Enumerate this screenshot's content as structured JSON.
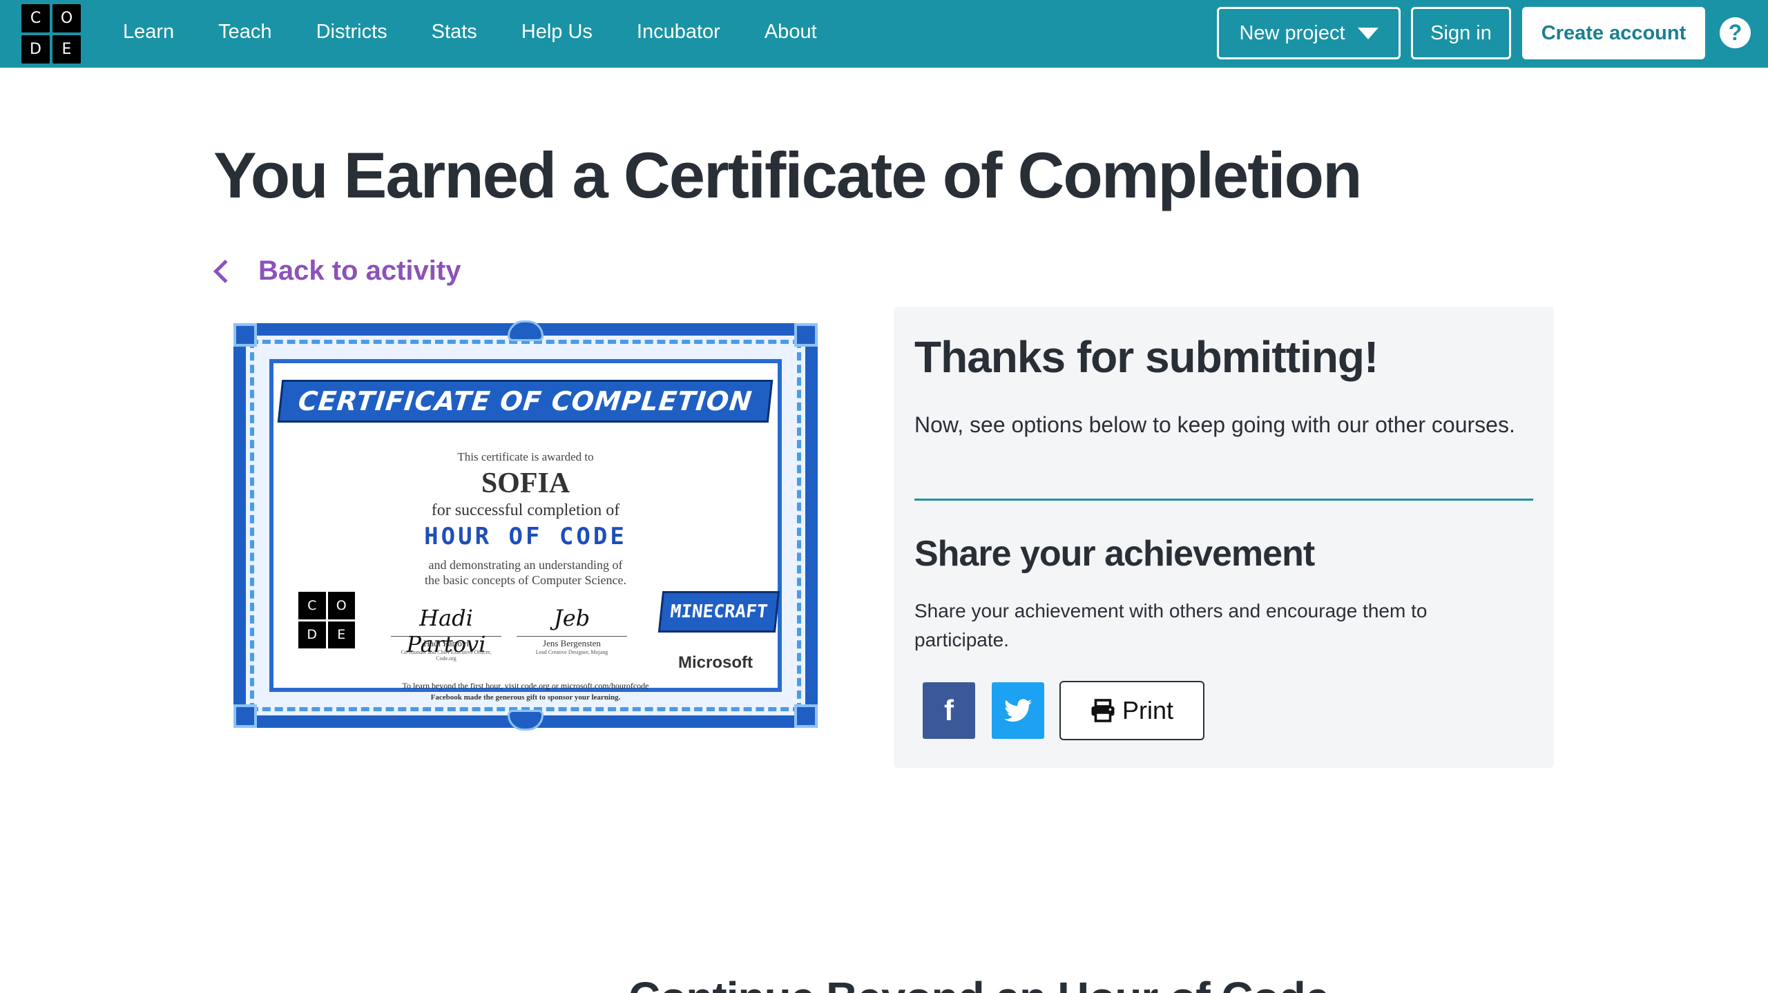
{
  "nav": {
    "logo_letters": [
      "C",
      "O",
      "D",
      "E"
    ],
    "links": [
      "Learn",
      "Teach",
      "Districts",
      "Stats",
      "Help Us",
      "Incubator",
      "About"
    ],
    "new_project_label": "New project",
    "sign_in_label": "Sign in",
    "create_account_label": "Create account",
    "help_icon": "?"
  },
  "page": {
    "title": "You Earned a Certificate of Completion",
    "back_link": "Back to activity"
  },
  "certificate": {
    "heading": "CERTIFICATE OF COMPLETION",
    "awarded_to_text": "This certificate is awarded to",
    "name": "SOFIA",
    "for_text": "for successful completion of",
    "course": "HOUR OF CODE",
    "demonstrating_line1": "and demonstrating an understanding of",
    "demonstrating_line2": "the basic concepts of Computer Science.",
    "signer1_signature": "Hadi Partovi",
    "signer1_name": "Hadi Partovi",
    "signer1_role": "Co-founder and Chief Executive Officer, Code.org",
    "signer2_signature": "Jeb",
    "signer2_name": "Jens Bergensten",
    "signer2_role": "Lead Creative Designer, Mojang",
    "partner_badge": "MINECRAFT",
    "partner_company": "Microsoft",
    "footer_line1": "To learn beyond the first hour, visit code.org or microsoft.com/hourofcode",
    "footer_line2": "Facebook made the generous gift to sponsor your learning."
  },
  "panel": {
    "thanks_title": "Thanks for submitting!",
    "thanks_text": "Now, see options below to keep going with our other courses.",
    "share_title": "Share your achievement",
    "share_text": "Share your achievement with others and encourage them to participate.",
    "facebook_label": "f",
    "print_label": "Print"
  },
  "next_section": {
    "heading": "Continue Beyond an Hour of Code"
  },
  "colors": {
    "nav_bg": "#1a93a6",
    "link_purple": "#8c52ba",
    "facebook": "#3b5998",
    "twitter": "#1da1f2",
    "panel_bg": "#f4f5f7"
  }
}
